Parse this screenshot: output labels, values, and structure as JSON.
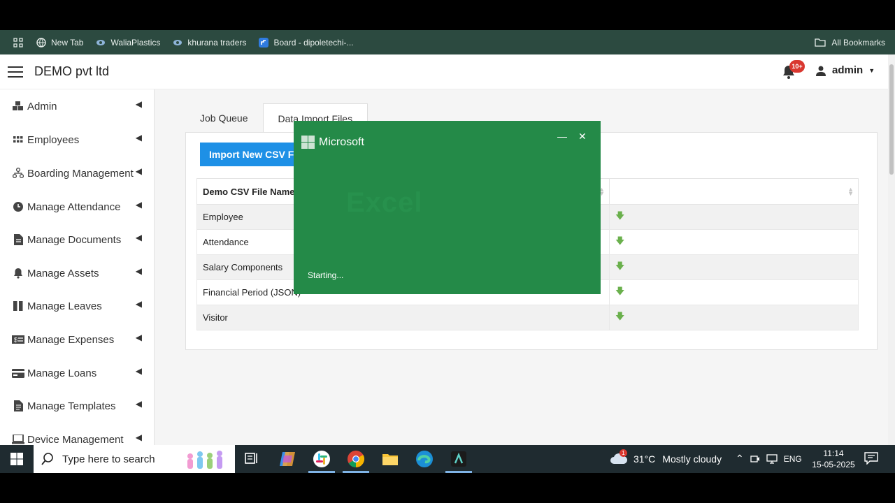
{
  "bookmarks": {
    "items": [
      {
        "label": "New Tab",
        "icon": "globe-icon"
      },
      {
        "label": "WaliaPlastics",
        "icon": "site-icon"
      },
      {
        "label": "khurana traders",
        "icon": "site-icon"
      },
      {
        "label": "Board - dipoletechi-...",
        "icon": "board-icon"
      }
    ],
    "all_bookmarks": "All Bookmarks"
  },
  "header": {
    "brand": "DEMO pvt ltd",
    "notification_count": "10+",
    "user": "admin"
  },
  "sidebar": {
    "items": [
      {
        "label": "Admin",
        "icon": "cubes-icon"
      },
      {
        "label": "Employees",
        "icon": "grid-icon"
      },
      {
        "label": "Boarding Management",
        "icon": "sitemap-icon"
      },
      {
        "label": "Manage Attendance",
        "icon": "clock-icon"
      },
      {
        "label": "Manage Documents",
        "icon": "document-icon"
      },
      {
        "label": "Manage Assets",
        "icon": "bell-icon"
      },
      {
        "label": "Manage Leaves",
        "icon": "columns-icon"
      },
      {
        "label": "Manage Expenses",
        "icon": "money-icon"
      },
      {
        "label": "Manage Loans",
        "icon": "card-icon"
      },
      {
        "label": "Manage Templates",
        "icon": "file-icon"
      },
      {
        "label": "Device Management",
        "icon": "laptop-icon"
      }
    ]
  },
  "main": {
    "tabs": [
      {
        "label": "Job Queue",
        "active": false
      },
      {
        "label": "Data Import Files",
        "active": true
      }
    ],
    "import_button": "Import New CSV File",
    "table": {
      "columns": [
        "Demo CSV File Name",
        ""
      ],
      "rows": [
        {
          "name": "Employee"
        },
        {
          "name": "Attendance"
        },
        {
          "name": "Salary Components"
        },
        {
          "name": "Financial Period (JSON)"
        },
        {
          "name": "Visitor"
        }
      ]
    }
  },
  "splash": {
    "brand": "Microsoft",
    "app_name": "Excel",
    "status": "Starting..."
  },
  "taskbar": {
    "search_placeholder": "Type here to search",
    "weather_alert": "1",
    "temperature": "31°C",
    "weather": "Mostly cloudy",
    "language": "ENG",
    "time": "11:14",
    "date": "15-05-2025"
  },
  "colors": {
    "splash_green": "#248a48",
    "primary_button": "#1e90e6",
    "download_green": "#6ab04c",
    "badge_red": "#d9372f"
  }
}
